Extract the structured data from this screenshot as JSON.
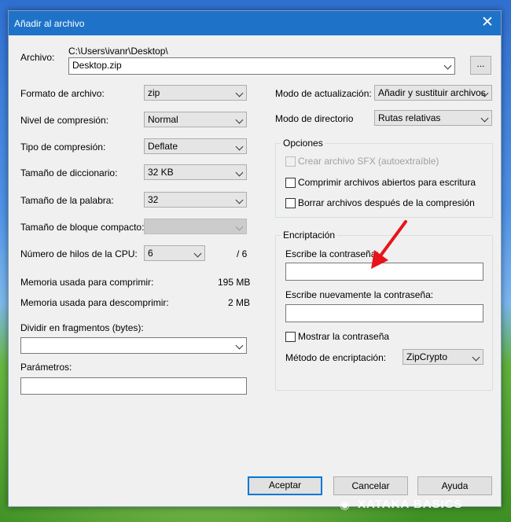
{
  "window": {
    "title": "Añadir al archivo"
  },
  "archive": {
    "label": "Archivo:",
    "path": "C:\\Users\\ivanr\\Desktop\\",
    "filename": "Desktop.zip",
    "browse_label": "..."
  },
  "left": {
    "format_label": "Formato de archivo:",
    "format_value": "zip",
    "level_label": "Nivel de compresión:",
    "level_value": "Normal",
    "method_label": "Tipo de compresión:",
    "method_value": "Deflate",
    "dict_label": "Tamaño de diccionario:",
    "dict_value": "32 KB",
    "word_label": "Tamaño de la palabra:",
    "word_value": "32",
    "solid_label": "Tamaño de bloque compacto:",
    "solid_value": "",
    "threads_label": "Número de hilos de la CPU:",
    "threads_value": "6",
    "threads_total": "/ 6",
    "mem_compress_label": "Memoria usada para comprimir:",
    "mem_compress_value": "195 MB",
    "mem_decompress_label": "Memoria usada para descomprimir:",
    "mem_decompress_value": "2 MB",
    "split_label": "Dividir en fragmentos (bytes):",
    "split_value": "",
    "params_label": "Parámetros:",
    "params_value": ""
  },
  "right": {
    "update_label": "Modo de actualización:",
    "update_value": "Añadir y sustituir archivos",
    "path_label": "Modo de directorio",
    "path_value": "Rutas relativas",
    "options_title": "Opciones",
    "opt_sfx": "Crear archivo SFX (autoextraíble)",
    "opt_shared": "Comprimir archivos abiertos para escritura",
    "opt_delete": "Borrar archivos después de la compresión",
    "enc_title": "Encriptación",
    "enc_password_label": "Escribe la contraseña:",
    "enc_repeat_label": "Escribe nuevamente la contraseña:",
    "enc_show": "Mostrar la contraseña",
    "enc_method_label": "Método de encriptación:",
    "enc_method_value": "ZipCrypto"
  },
  "buttons": {
    "ok": "Aceptar",
    "cancel": "Cancelar",
    "help": "Ayuda"
  },
  "watermark": {
    "text": "XATAKA BASICS"
  },
  "colors": {
    "titlebar": "#1e73c8",
    "annotation_arrow": "#e8141b",
    "focus_border": "#0078d7"
  }
}
